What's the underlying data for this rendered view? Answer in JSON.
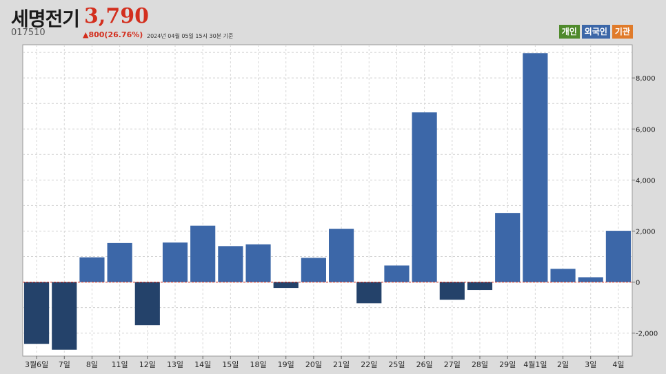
{
  "header": {
    "name": "세명전기",
    "price": "3,790",
    "code": "017510",
    "change": "▲800(26.76%)",
    "timestamp": "2024년 04월 05일 15시 30분 기준"
  },
  "legend": [
    {
      "label": "개인",
      "color": "#4f8a2c"
    },
    {
      "label": "외국인",
      "color": "#3c67a8"
    },
    {
      "label": "기관",
      "color": "#e07b2a"
    }
  ],
  "chart_data": {
    "type": "bar",
    "series_name": "외국인",
    "categories": [
      "3월6일",
      "7일",
      "8일",
      "11일",
      "12일",
      "13일",
      "14일",
      "15일",
      "18일",
      "19일",
      "20일",
      "21일",
      "22일",
      "25일",
      "26일",
      "27일",
      "28일",
      "29일",
      "4월1일",
      "2일",
      "3일",
      "4일"
    ],
    "values": [
      -2420,
      -2650,
      970,
      1530,
      -1690,
      1550,
      2210,
      1410,
      1480,
      -230,
      950,
      2090,
      -830,
      650,
      6650,
      -690,
      -310,
      2710,
      8970,
      520,
      190,
      2010
    ],
    "ylim": [
      -2900,
      9300
    ],
    "yticks": [
      -2000,
      0,
      2000,
      4000,
      6000,
      8000
    ],
    "ytick_labels": [
      "-2,000",
      "0",
      "2,000",
      "4,000",
      "6,000",
      "8,000"
    ],
    "positive_color": "#3c67a8",
    "negative_color": "#24426a",
    "zero_line_color": "#d32f1e",
    "grid": true,
    "axis_position": "right"
  }
}
